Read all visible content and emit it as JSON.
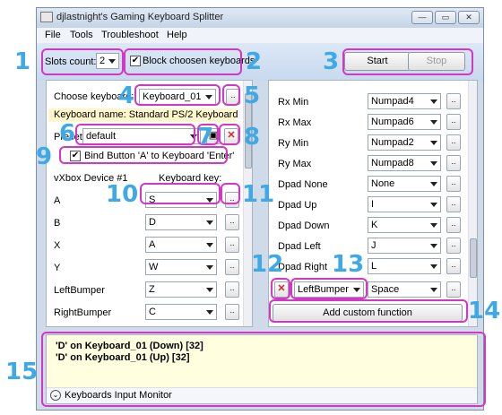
{
  "window": {
    "title": "djlastnight's Gaming Keyboard Splitter",
    "controls": [
      "—",
      "▭",
      "✕"
    ]
  },
  "menu": [
    "File",
    "Tools",
    "Troubleshoot",
    "Help"
  ],
  "toolbar": {
    "slots_label": "Slots count:",
    "slots_value": "2",
    "block_label": "Block choosen keyboards",
    "block_checked": true,
    "start": "Start",
    "stop": "Stop"
  },
  "left": {
    "choose_label": "Choose keyboard:",
    "keyboard_value": "Keyboard_01",
    "dots": "..",
    "keyboard_name": "Keyboard name: Standard PS/2 Keyboard",
    "preset_label": "Preset:",
    "preset_value": "default",
    "bind_label": "Bind Button 'A' to Keyboard 'Enter'",
    "device_label": "vXbox Device #1",
    "key_label": "Keyboard key:",
    "rows": [
      {
        "name": "A",
        "key": "S"
      },
      {
        "name": "B",
        "key": "D"
      },
      {
        "name": "X",
        "key": "A"
      },
      {
        "name": "Y",
        "key": "W"
      },
      {
        "name": "LeftBumper",
        "key": "Z"
      },
      {
        "name": "RightBumper",
        "key": "C"
      }
    ]
  },
  "right": {
    "rows": [
      {
        "name": "Rx Min",
        "key": "Numpad4"
      },
      {
        "name": "Rx Max",
        "key": "Numpad6"
      },
      {
        "name": "Ry Min",
        "key": "Numpad2"
      },
      {
        "name": "Ry Max",
        "key": "Numpad8"
      },
      {
        "name": "Dpad None",
        "key": "None"
      },
      {
        "name": "Dpad Up",
        "key": "I"
      },
      {
        "name": "Dpad Down",
        "key": "K"
      },
      {
        "name": "Dpad Left",
        "key": "J"
      },
      {
        "name": "Dpad Right",
        "key": "L"
      }
    ],
    "custom_button": "LeftBumper",
    "custom_key": "Space",
    "add_custom": "Add custom function"
  },
  "monitor": {
    "lines": [
      "'D' on Keyboard_01 (Down) [32]",
      "'D' on Keyboard_01 (Up) [32]"
    ],
    "label": "Keyboards Input Monitor"
  },
  "callouts": [
    "1",
    "2",
    "3",
    "4",
    "5",
    "6",
    "7",
    "8",
    "9",
    "10",
    "11",
    "12",
    "13",
    "14",
    "15"
  ],
  "colors": {
    "highlight": "#d436c6",
    "callout": "#3fa9e6",
    "name_bg": "#fff7cc",
    "monitor_bg": "#ffffe0"
  }
}
